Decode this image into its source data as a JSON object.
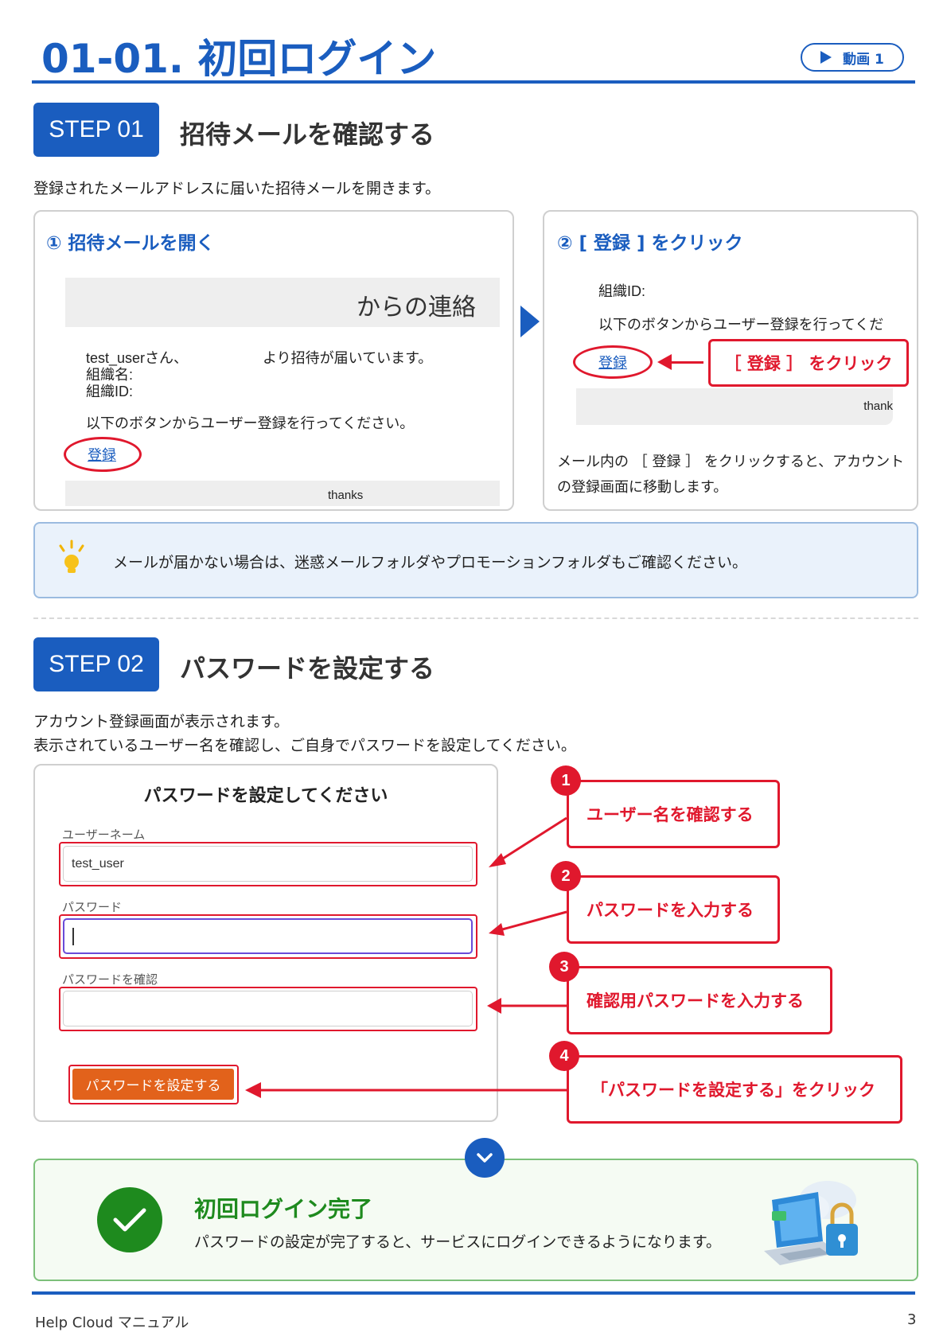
{
  "header": {
    "title": "01-01. 初回ログイン",
    "video_label": "動画 1"
  },
  "step1": {
    "badge": "STEP 01",
    "title": "招待メールを確認する",
    "description": "登録されたメールアドレスに届いた招待メールを開きます。",
    "card1": {
      "heading": "① 招待メールを開く",
      "mail_header": "からの連絡",
      "greeting": "test_userさん、",
      "invite_text": "より招待が届いています。",
      "org_name_label": "組織名:",
      "org_id_label": "組織ID:",
      "instruction": "以下のボタンからユーザー登録を行ってください。",
      "register_link": "登録",
      "footer_text": "thanks"
    },
    "card2": {
      "heading": "② [ 登録 ] をクリック",
      "org_id_label": "組織ID:",
      "instruction": "以下のボタンからユーザー登録を行ってくだ",
      "register_link": "登録",
      "callout": "［ 登録 ］ をクリック",
      "footer_text": "thank",
      "note_line1": "メール内の ［ 登録 ］ をクリックすると、アカウント",
      "note_line2": "の登録画面に移動します。"
    },
    "tip": "メールが届かない場合は、迷惑メールフォルダやプロモーションフォルダもご確認ください。"
  },
  "step2": {
    "badge": "STEP 02",
    "title": "パスワードを設定する",
    "description_line1": "アカウント登録画面が表示されます。",
    "description_line2": "表示されているユーザー名を確認し、ご自身でパスワードを設定してください。",
    "form": {
      "title": "パスワードを設定してください",
      "username_label": "ユーザーネーム",
      "username_value": "test_user",
      "password_label": "パスワード",
      "confirm_label": "パスワードを確認",
      "submit_label": "パスワードを設定する"
    },
    "callouts": [
      {
        "num": "1",
        "text": "ユーザー名を確認する"
      },
      {
        "num": "2",
        "text": "パスワードを入力する"
      },
      {
        "num": "3",
        "text": "確認用パスワードを入力する"
      },
      {
        "num": "4",
        "text": "「パスワードを設定する」をクリック"
      }
    ]
  },
  "completion": {
    "title": "初回ログイン完了",
    "text": "パスワードの設定が完了すると、サービスにログインできるようになります。"
  },
  "footer": {
    "manual": "Help Cloud マニュアル",
    "page": "3"
  },
  "colors": {
    "brand_blue": "#1a5dbf",
    "accent_red": "#e0182d",
    "success_green": "#1e8a1e",
    "button_orange": "#e2621b"
  }
}
